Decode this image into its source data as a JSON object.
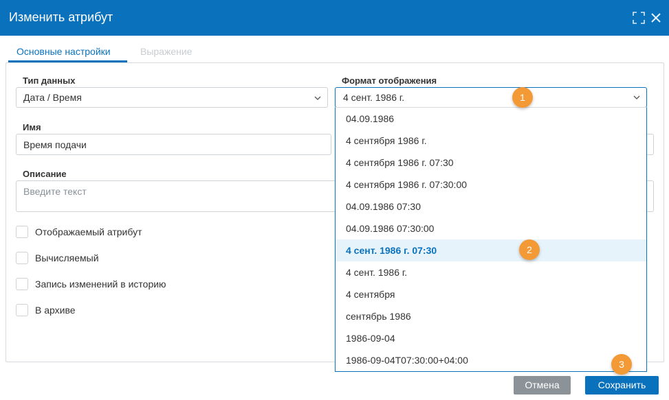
{
  "dialog": {
    "title": "Изменить атрибут"
  },
  "tabs": [
    {
      "label": "Основные настройки",
      "active": true
    },
    {
      "label": "Выражение",
      "active": false
    }
  ],
  "form": {
    "data_type": {
      "label": "Тип данных",
      "value": "Дата / Время"
    },
    "name": {
      "label": "Имя",
      "value": "Время подачи"
    },
    "description": {
      "label": "Описание",
      "placeholder": "Введите текст"
    },
    "display_format": {
      "label": "Формат отображения",
      "value": "4 сент. 1986 г.",
      "options": [
        "04.09.1986",
        "4 сентября 1986 г.",
        "4 сентября 1986 г. 07:30",
        "4 сентября 1986 г. 07:30:00",
        "04.09.1986 07:30",
        "04.09.1986 07:30:00",
        "4 сент. 1986 г. 07:30",
        "4 сент. 1986 г.",
        "4 сентября",
        "сентябрь 1986",
        "1986-09-04",
        "1986-09-04T07:30:00+04:00"
      ],
      "highlighted_option": "4 сент. 1986 г. 07:30"
    },
    "checkboxes": [
      {
        "label": "Отображаемый атрибут",
        "checked": false
      },
      {
        "label": "Вычисляемый",
        "checked": false
      },
      {
        "label": "Запись изменений в историю",
        "checked": false
      },
      {
        "label": "В архиве",
        "checked": false
      }
    ]
  },
  "badges": [
    "1",
    "2",
    "3"
  ],
  "buttons": {
    "cancel": "Отмена",
    "save": "Сохранить"
  },
  "icons": {
    "maximize": "maximize-icon",
    "close": "close-icon",
    "chevron": "chevron-down-icon"
  },
  "colors": {
    "primary": "#0a72bd",
    "badge": "#f39a37",
    "cancel": "#8c9398",
    "highlight_bg": "#e6f3fb"
  }
}
